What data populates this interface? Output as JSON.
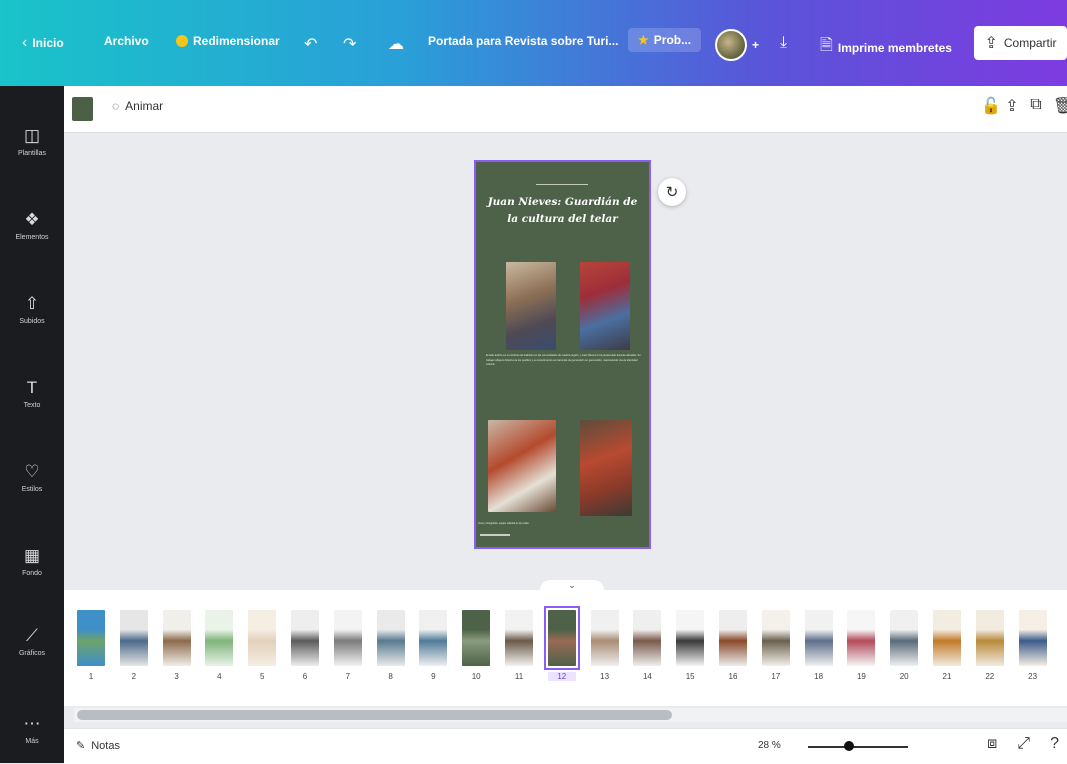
{
  "topbar": {
    "home": "Inicio",
    "file": "Archivo",
    "resize": "Redimensionar",
    "undo_icon": "↶",
    "redo_icon": "↷",
    "cloud_icon": "☁",
    "doc_title": "Portada para Revista sobre Turi...",
    "pro_label": "Prob...",
    "plus": "+",
    "download_icon": "⤓",
    "print_icon": "🗎",
    "print_label": "Imprime membretes",
    "share_icon": "⇪",
    "share_label": "Compartir"
  },
  "sidebar": {
    "items": [
      {
        "icon": "◫",
        "label": "Plantillas"
      },
      {
        "icon": "❖",
        "label": "Elementos"
      },
      {
        "icon": "⇧",
        "label": "Subidos"
      },
      {
        "icon": "T",
        "label": "Texto"
      },
      {
        "icon": "♡",
        "label": "Estilos"
      },
      {
        "icon": "▦",
        "label": "Fondo"
      },
      {
        "icon": "⟋",
        "label": "Gráficos"
      },
      {
        "icon": "⋯",
        "label": "Más"
      }
    ]
  },
  "toolbar": {
    "animate_label": "Animar",
    "animate_icon": "◌",
    "lock_icon": "🔓",
    "share_page_icon": "⇪",
    "duplicate_icon": "⧉",
    "delete_icon": "🗑",
    "swatch_color": "#4c5f47"
  },
  "page": {
    "title": "Juan Nieves: Guardián de la cultura del telar",
    "body": "El telar andino es un símbolo de tradición en las comunidades de nuestra región, y Juan Nieves lo ha preservado durante décadas. Su trabajo refleja la historia de los pueblos y su conocimiento se transmite de generación en generación, manteniendo viva la identidad cultural.",
    "footer": "Texto y fotografías: equipo editorial de la revista",
    "rotate_icon": "↻",
    "background": "#4d6248",
    "selection_color": "#8b5cf6"
  },
  "thumbnails": {
    "pages": [
      "1",
      "2",
      "3",
      "4",
      "5",
      "6",
      "7",
      "8",
      "9",
      "10",
      "11",
      "12",
      "13",
      "14",
      "15",
      "16",
      "17",
      "18",
      "19",
      "20",
      "21",
      "22",
      "23"
    ],
    "selected": "12"
  },
  "bottombar": {
    "notes_icon": "✎",
    "notes_label": "Notas",
    "zoom": "28 %",
    "zoom_fraction": 0.28,
    "pages_icon": "⧈",
    "fullscreen_icon": "⤢",
    "help_icon": "?"
  }
}
